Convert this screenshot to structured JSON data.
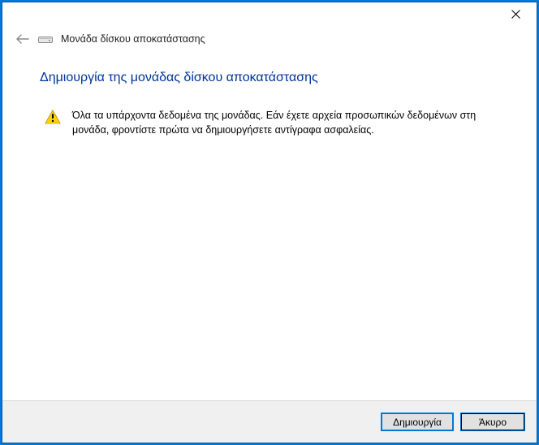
{
  "titlebar": {
    "close_aria": "Close"
  },
  "header": {
    "back_aria": "Back",
    "disk_icon": "disk-icon",
    "title": "Μονάδα δίσκου αποκατάστασης"
  },
  "main": {
    "heading": "Δημιουργία της μονάδας δίσκου αποκατάστασης",
    "warning_icon": "warning-icon",
    "warning_text": "Όλα τα υπάρχοντα δεδομένα της μονάδας. Εάν έχετε αρχεία προσωπικών δεδομένων στη μονάδα, φροντίστε πρώτα να δημιουργήσετε αντίγραφα ασφαλείας."
  },
  "buttons": {
    "create": "Δημιουργία",
    "cancel": "Άκυρο"
  }
}
